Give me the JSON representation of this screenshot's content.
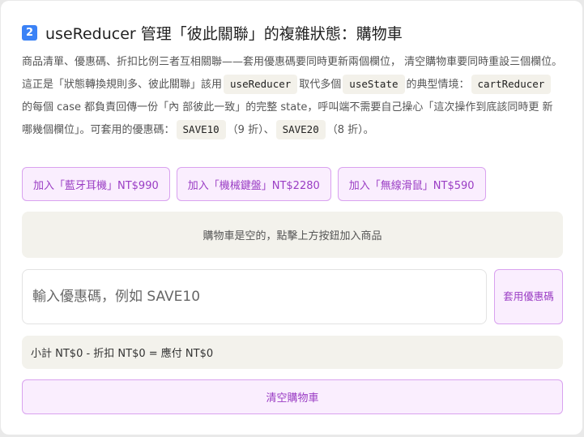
{
  "header": {
    "badge": "2",
    "title": "useReducer 管理「彼此關聯」的複雜狀態：購物車"
  },
  "description": {
    "part1": "商品清單、優惠碼、折扣比例三者互相關聯——套用優惠碼要同時更新兩個欄位， 清空購物車要同時重設三個欄位。這正是「狀態轉換規則多、彼此關聯」該用",
    "code1": "useReducer",
    "part2": "取代多個",
    "code2": "useState",
    "part3": "的典型情境：",
    "code3": "cartReducer",
    "part4": "的每個 case 都負責回傳一份「內 部彼此一致」的完整 state，呼叫端不需要自己操心「這次操作到底該同時更 新哪幾個欄位」。可套用的優惠碼：",
    "code4": "SAVE10",
    "part5": "（9 折）、",
    "code5": "SAVE20",
    "part6": "（8 折）。"
  },
  "products": [
    {
      "label": "加入「藍牙耳機」NT$990"
    },
    {
      "label": "加入「機械鍵盤」NT$2280"
    },
    {
      "label": "加入「無線滑鼠」NT$590"
    }
  ],
  "cart": {
    "empty_message": "購物車是空的，點擊上方按鈕加入商品"
  },
  "coupon": {
    "value": "",
    "placeholder": "輸入優惠碼，例如 SAVE10",
    "apply_label": "套用優惠碼"
  },
  "summary": {
    "text": "小計 NT$0 - 折扣 NT$0 = 應付 NT$0"
  },
  "actions": {
    "clear_label": "清空購物車"
  },
  "colors": {
    "accent": "#9a3dc4",
    "button_bg": "#faeefe",
    "button_border": "#d9a2ef",
    "badge": "#3b82f6",
    "panel_bg": "#f3f2ec"
  }
}
